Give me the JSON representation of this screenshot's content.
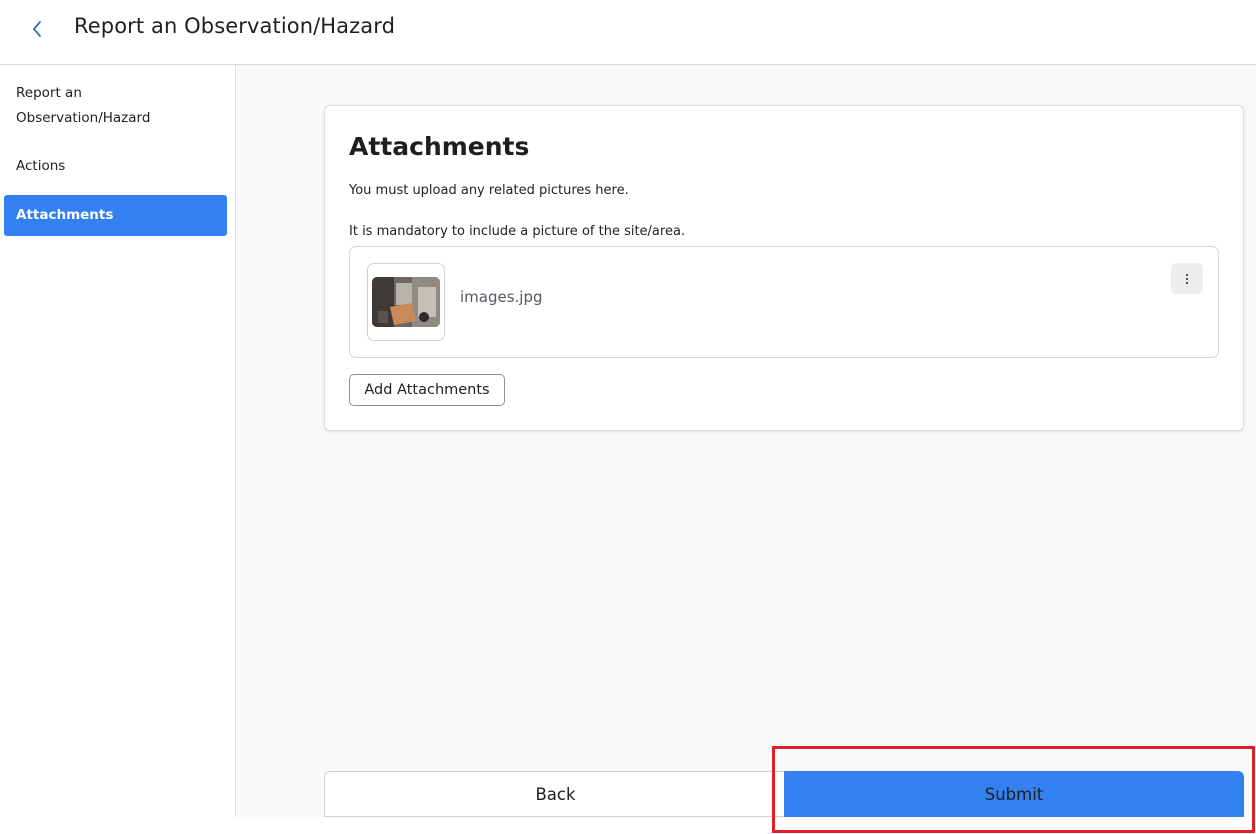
{
  "header": {
    "title": "Report an Observation/Hazard",
    "back_icon": "chevron-left-icon"
  },
  "sidebar": {
    "items": [
      {
        "label": "Report an Observation/Hazard",
        "active": false
      },
      {
        "label": "Actions",
        "active": false
      },
      {
        "label": "Attachments",
        "active": true
      }
    ]
  },
  "card": {
    "title": "Attachments",
    "instruction_1": "You must upload any related pictures here.",
    "instruction_2": "It is mandatory to include a picture of the site/area.",
    "attachments": [
      {
        "file_name": "images.jpg",
        "menu_icon": "kebab-menu-icon"
      }
    ],
    "add_button_label": "Add Attachments"
  },
  "footer": {
    "back_label": "Back",
    "submit_label": "Submit"
  },
  "colors": {
    "accent": "#3381f0",
    "highlight": "#e01f26",
    "background": "#f8f9fa"
  }
}
